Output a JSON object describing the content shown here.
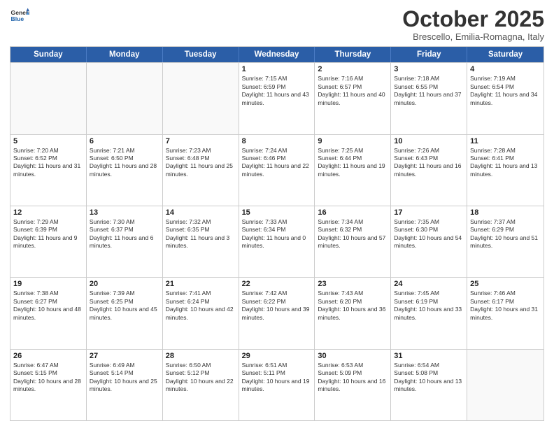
{
  "header": {
    "logo_line1": "General",
    "logo_line2": "Blue",
    "month": "October 2025",
    "location": "Brescello, Emilia-Romagna, Italy"
  },
  "days_of_week": [
    "Sunday",
    "Monday",
    "Tuesday",
    "Wednesday",
    "Thursday",
    "Friday",
    "Saturday"
  ],
  "rows": [
    [
      {
        "day": "",
        "empty": true
      },
      {
        "day": "",
        "empty": true
      },
      {
        "day": "",
        "empty": true
      },
      {
        "day": "1",
        "sunrise": "7:15 AM",
        "sunset": "6:59 PM",
        "daylight": "11 hours and 43 minutes."
      },
      {
        "day": "2",
        "sunrise": "7:16 AM",
        "sunset": "6:57 PM",
        "daylight": "11 hours and 40 minutes."
      },
      {
        "day": "3",
        "sunrise": "7:18 AM",
        "sunset": "6:55 PM",
        "daylight": "11 hours and 37 minutes."
      },
      {
        "day": "4",
        "sunrise": "7:19 AM",
        "sunset": "6:54 PM",
        "daylight": "11 hours and 34 minutes."
      }
    ],
    [
      {
        "day": "5",
        "sunrise": "7:20 AM",
        "sunset": "6:52 PM",
        "daylight": "11 hours and 31 minutes."
      },
      {
        "day": "6",
        "sunrise": "7:21 AM",
        "sunset": "6:50 PM",
        "daylight": "11 hours and 28 minutes."
      },
      {
        "day": "7",
        "sunrise": "7:23 AM",
        "sunset": "6:48 PM",
        "daylight": "11 hours and 25 minutes."
      },
      {
        "day": "8",
        "sunrise": "7:24 AM",
        "sunset": "6:46 PM",
        "daylight": "11 hours and 22 minutes."
      },
      {
        "day": "9",
        "sunrise": "7:25 AM",
        "sunset": "6:44 PM",
        "daylight": "11 hours and 19 minutes."
      },
      {
        "day": "10",
        "sunrise": "7:26 AM",
        "sunset": "6:43 PM",
        "daylight": "11 hours and 16 minutes."
      },
      {
        "day": "11",
        "sunrise": "7:28 AM",
        "sunset": "6:41 PM",
        "daylight": "11 hours and 13 minutes."
      }
    ],
    [
      {
        "day": "12",
        "sunrise": "7:29 AM",
        "sunset": "6:39 PM",
        "daylight": "11 hours and 9 minutes."
      },
      {
        "day": "13",
        "sunrise": "7:30 AM",
        "sunset": "6:37 PM",
        "daylight": "11 hours and 6 minutes."
      },
      {
        "day": "14",
        "sunrise": "7:32 AM",
        "sunset": "6:35 PM",
        "daylight": "11 hours and 3 minutes."
      },
      {
        "day": "15",
        "sunrise": "7:33 AM",
        "sunset": "6:34 PM",
        "daylight": "11 hours and 0 minutes."
      },
      {
        "day": "16",
        "sunrise": "7:34 AM",
        "sunset": "6:32 PM",
        "daylight": "10 hours and 57 minutes."
      },
      {
        "day": "17",
        "sunrise": "7:35 AM",
        "sunset": "6:30 PM",
        "daylight": "10 hours and 54 minutes."
      },
      {
        "day": "18",
        "sunrise": "7:37 AM",
        "sunset": "6:29 PM",
        "daylight": "10 hours and 51 minutes."
      }
    ],
    [
      {
        "day": "19",
        "sunrise": "7:38 AM",
        "sunset": "6:27 PM",
        "daylight": "10 hours and 48 minutes."
      },
      {
        "day": "20",
        "sunrise": "7:39 AM",
        "sunset": "6:25 PM",
        "daylight": "10 hours and 45 minutes."
      },
      {
        "day": "21",
        "sunrise": "7:41 AM",
        "sunset": "6:24 PM",
        "daylight": "10 hours and 42 minutes."
      },
      {
        "day": "22",
        "sunrise": "7:42 AM",
        "sunset": "6:22 PM",
        "daylight": "10 hours and 39 minutes."
      },
      {
        "day": "23",
        "sunrise": "7:43 AM",
        "sunset": "6:20 PM",
        "daylight": "10 hours and 36 minutes."
      },
      {
        "day": "24",
        "sunrise": "7:45 AM",
        "sunset": "6:19 PM",
        "daylight": "10 hours and 33 minutes."
      },
      {
        "day": "25",
        "sunrise": "7:46 AM",
        "sunset": "6:17 PM",
        "daylight": "10 hours and 31 minutes."
      }
    ],
    [
      {
        "day": "26",
        "sunrise": "6:47 AM",
        "sunset": "5:15 PM",
        "daylight": "10 hours and 28 minutes."
      },
      {
        "day": "27",
        "sunrise": "6:49 AM",
        "sunset": "5:14 PM",
        "daylight": "10 hours and 25 minutes."
      },
      {
        "day": "28",
        "sunrise": "6:50 AM",
        "sunset": "5:12 PM",
        "daylight": "10 hours and 22 minutes."
      },
      {
        "day": "29",
        "sunrise": "6:51 AM",
        "sunset": "5:11 PM",
        "daylight": "10 hours and 19 minutes."
      },
      {
        "day": "30",
        "sunrise": "6:53 AM",
        "sunset": "5:09 PM",
        "daylight": "10 hours and 16 minutes."
      },
      {
        "day": "31",
        "sunrise": "6:54 AM",
        "sunset": "5:08 PM",
        "daylight": "10 hours and 13 minutes."
      },
      {
        "day": "",
        "empty": true
      }
    ]
  ]
}
